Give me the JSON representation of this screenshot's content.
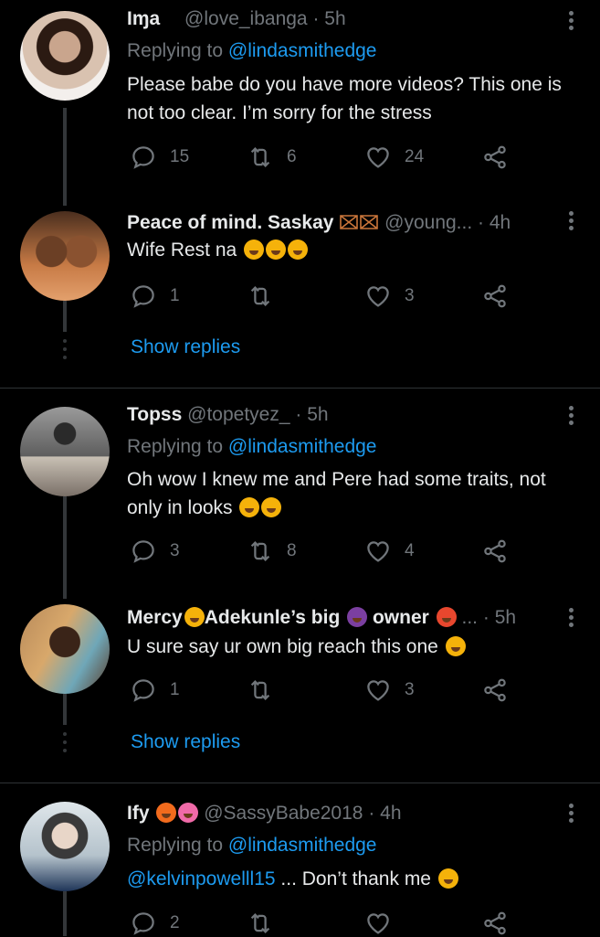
{
  "tweets": [
    {
      "name": "Iɱa ",
      "handle": "@love_ibanga",
      "time": "· 5h",
      "replying_prefix": "Replying to ",
      "replying_user": "@lindasmithedge",
      "text": "Please babe do you have more videos? This one is not too clear. I’m sorry for the stress",
      "replies": "15",
      "retweets": "6",
      "likes": "24"
    },
    {
      "name": "Peace of mind. Saskay",
      "handle": "@young...",
      "time": "· 4h",
      "text": "Wife Rest na",
      "replies": "1",
      "retweets": "",
      "likes": "3",
      "show_replies": "Show replies"
    },
    {
      "name": "Topss",
      "handle": "@topetyez_",
      "time": "· 5h",
      "replying_prefix": "Replying to ",
      "replying_user": "@lindasmithedge",
      "text": "Oh wow I knew me and Pere had some traits, not only in looks",
      "replies": "3",
      "retweets": "8",
      "likes": "4"
    },
    {
      "name_a": "Mercy",
      "name_b": "Adekunle’s big",
      "name_c": "owner",
      "handle": "...",
      "time": "· 5h",
      "text": "U sure say ur own big reach this one",
      "replies": "1",
      "retweets": "",
      "likes": "3",
      "show_replies": "Show replies"
    },
    {
      "name": "Ify",
      "handle": "@SassyBabe2018",
      "time": "· 4h",
      "replying_prefix": "Replying to ",
      "replying_user": "@lindasmithedge",
      "mention": "@kelvinpowelll15",
      "text": " ... Don’t thank me",
      "replies": "2",
      "retweets": "",
      "likes": ""
    }
  ],
  "colors": {
    "background": "#000000",
    "accent": "#1d9bf0",
    "muted": "#71767b",
    "text": "#e7e9ea"
  },
  "icons": [
    "reply-icon",
    "retweet-icon",
    "like-icon",
    "share-icon",
    "more-icon"
  ]
}
